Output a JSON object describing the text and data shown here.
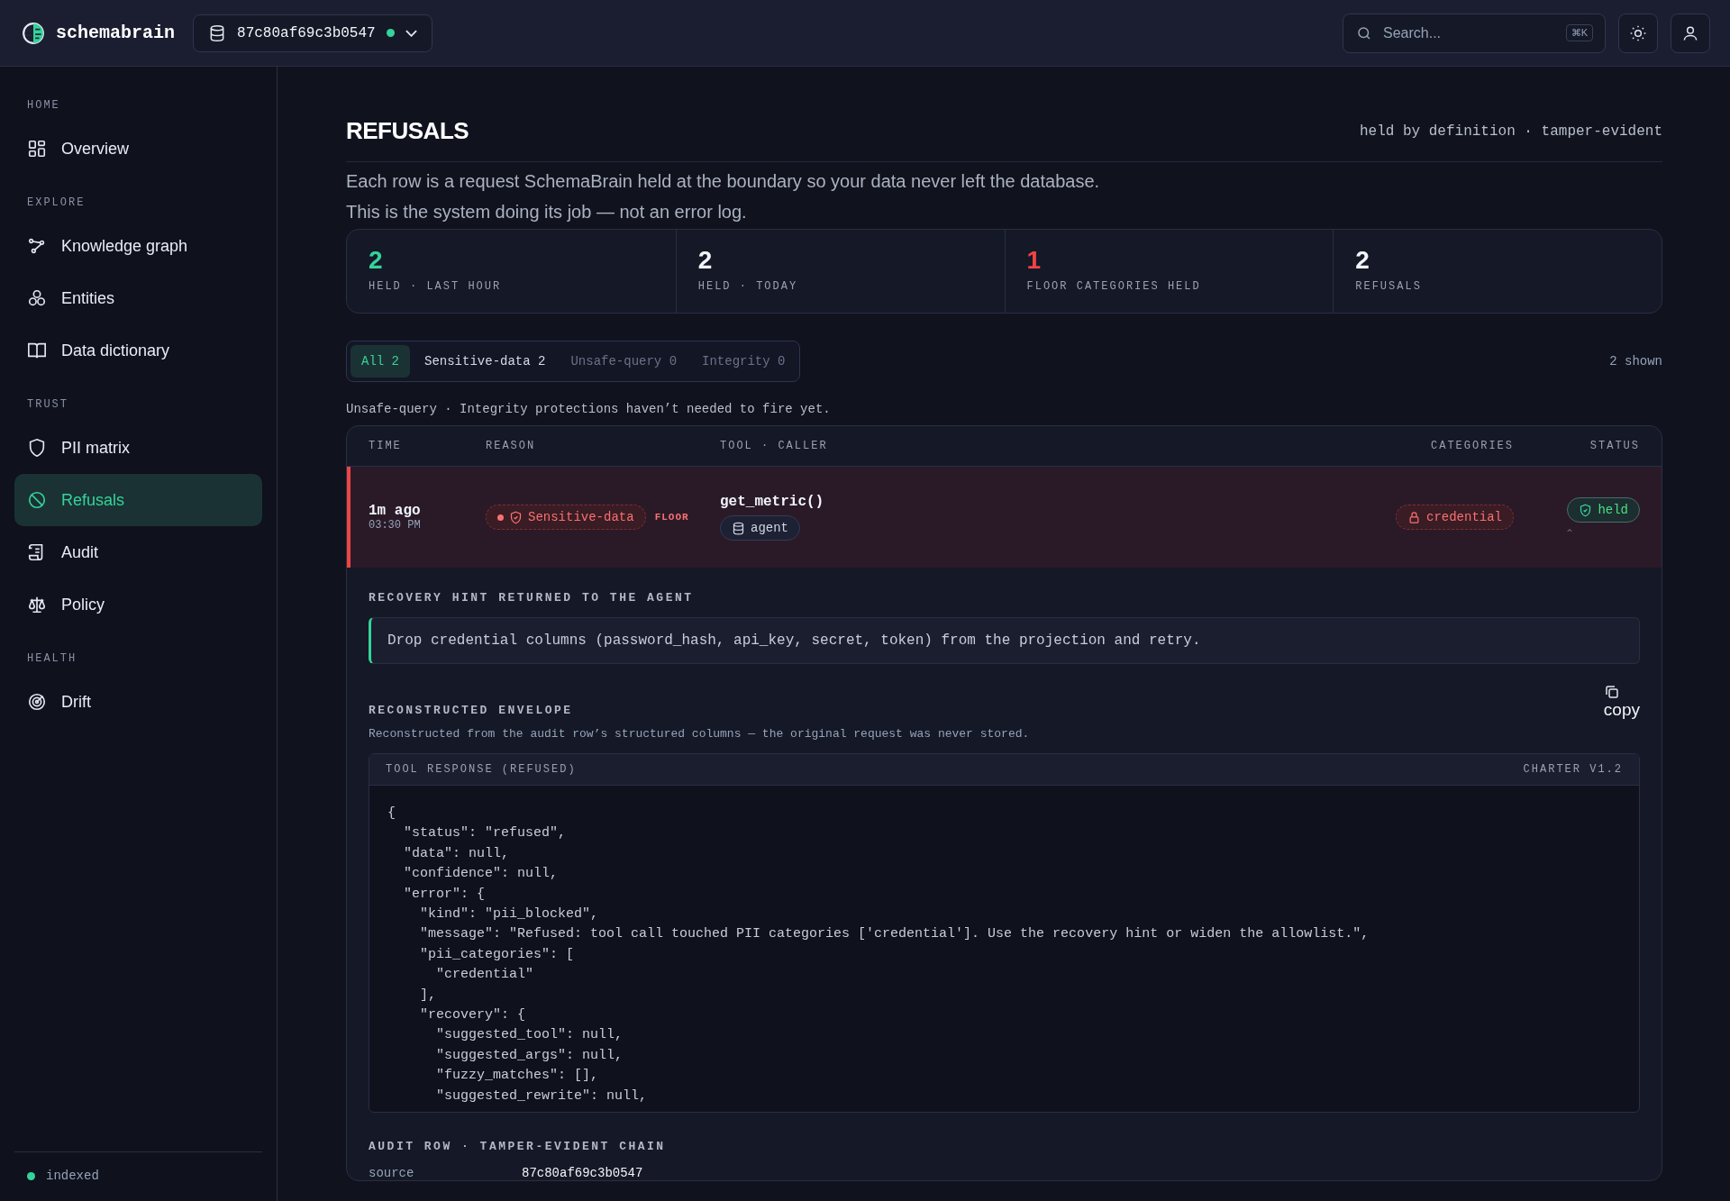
{
  "topbar": {
    "brand": "schemabrain",
    "database": {
      "name": "87c80af69c3b0547",
      "connected": true
    },
    "search": {
      "placeholder": "Search...",
      "shortcut": "⌘K"
    }
  },
  "sidebar": {
    "sections": [
      {
        "heading": "HOME",
        "items": [
          {
            "label": "Overview",
            "selected": false
          }
        ]
      },
      {
        "heading": "EXPLORE",
        "items": [
          {
            "label": "Knowledge graph",
            "selected": false
          },
          {
            "label": "Entities",
            "selected": false
          },
          {
            "label": "Data dictionary",
            "selected": false
          }
        ]
      },
      {
        "heading": "TRUST",
        "items": [
          {
            "label": "PII matrix",
            "selected": false
          },
          {
            "label": "Refusals",
            "selected": true
          },
          {
            "label": "Audit",
            "selected": false
          },
          {
            "label": "Policy",
            "selected": false
          }
        ]
      },
      {
        "heading": "HEALTH",
        "items": [
          {
            "label": "Drift",
            "selected": false
          }
        ]
      }
    ],
    "status": {
      "label": "indexed",
      "color": "#34d399"
    }
  },
  "page": {
    "title": "REFUSALS",
    "tagline": "held by definition · tamper-evident",
    "description": [
      "Each row is a request SchemaBrain held at the boundary so your data never left the database.",
      "This is the system doing its job — not an error log."
    ],
    "stats": [
      {
        "value": "2",
        "label": "HELD · LAST HOUR",
        "color": "#34d399"
      },
      {
        "value": "2",
        "label": "HELD · TODAY",
        "color": "#f1f5f9"
      },
      {
        "value": "1",
        "label": "FLOOR CATEGORIES HELD",
        "color": "#ef4444"
      },
      {
        "value": "2",
        "label": "REFUSALS",
        "color": "#f1f5f9"
      }
    ],
    "filters": [
      {
        "label": "All",
        "count": "2",
        "selected": true,
        "disabled": false
      },
      {
        "label": "Sensitive-data",
        "count": "2",
        "selected": false,
        "disabled": false
      },
      {
        "label": "Unsafe-query",
        "count": "0",
        "selected": false,
        "disabled": true
      },
      {
        "label": "Integrity",
        "count": "0",
        "selected": false,
        "disabled": true
      }
    ],
    "shown": "2 shown",
    "note": "Unsafe-query · Integrity protections haven’t needed to fire yet.",
    "table": {
      "columns": [
        "TIME",
        "REASON",
        "TOOL · CALLER",
        "CATEGORIES",
        "STATUS"
      ],
      "rows": [
        {
          "time": "1m ago",
          "clock": "03:30 PM",
          "reason": "Sensitive-data",
          "floor": "FLOOR",
          "tool": "get_metric()",
          "caller": "agent",
          "category": "credential",
          "status": "held",
          "expanded": true,
          "detail": {
            "hint_title": "RECOVERY HINT RETURNED TO THE AGENT",
            "hint": "Drop credential columns (password_hash, api_key, secret, token) from the projection and retry.",
            "envelope_title": "RECONSTRUCTED ENVELOPE",
            "copy": "copy",
            "envelope_note": "Reconstructed from the audit row’s structured columns — the original request was never stored.",
            "code_title": "TOOL RESPONSE (REFUSED)",
            "charter": "CHARTER V1.2",
            "code": [
              "{",
              "  \"status\": \"refused\",",
              "  \"data\": null,",
              "  \"confidence\": null,",
              "  \"error\": {",
              "    \"kind\": \"pii_blocked\",",
              "    \"message\": \"Refused: tool call touched PII categories ['credential']. Use the recovery hint or widen the allowlist.\",",
              "    \"pii_categories\": [",
              "      \"credential\"",
              "    ],",
              "    \"recovery\": {",
              "      \"suggested_tool\": null,",
              "      \"suggested_args\": null,",
              "      \"fuzzy_matches\": [],",
              "      \"suggested_rewrite\": null,"
            ],
            "audit_title": "AUDIT ROW · TAMPER-EVIDENT CHAIN",
            "audit": [
              {
                "key": "source",
                "value": "87c80af69c3b0547"
              }
            ]
          }
        }
      ]
    }
  }
}
